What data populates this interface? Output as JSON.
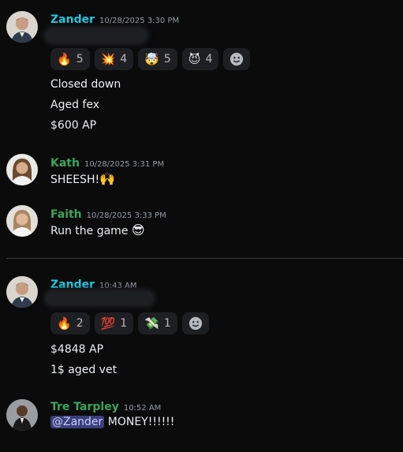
{
  "messages": [
    {
      "author": "Zander",
      "author_color": "#1ecbe1",
      "timestamp": "10/28/2025 3:30 PM",
      "reactions": [
        {
          "emoji": "🔥",
          "count": "5"
        },
        {
          "emoji": "💥",
          "count": "4"
        },
        {
          "emoji": "🤯",
          "count": "5"
        },
        {
          "emoji": "😈",
          "count": "4"
        }
      ],
      "lines": [
        "Closed down",
        "Aged fex",
        "$600 AP"
      ]
    },
    {
      "author": "Kath",
      "author_color": "#3ba55d",
      "timestamp": "10/28/2025 3:31 PM",
      "text": "SHEESH!",
      "emoji": "🙌"
    },
    {
      "author": "Faith",
      "author_color": "#3ba55d",
      "timestamp": "10/28/2025 3:33 PM",
      "text": "Run the game",
      "emoji": "😎"
    },
    {
      "author": "Zander",
      "author_color": "#1ecbe1",
      "timestamp": "10:43 AM",
      "reactions": [
        {
          "emoji": "🔥",
          "count": "2"
        },
        {
          "emoji": "💯",
          "count": "1"
        },
        {
          "emoji": "💸",
          "count": "1"
        }
      ],
      "lines": [
        "$4848 AP",
        "1$ aged vet"
      ]
    },
    {
      "author": "Tre Tarpley",
      "author_color": "#3ba55d",
      "timestamp": "10:52 AM",
      "mention": "@Zander",
      "text": "MONEY!!!!!!"
    }
  ],
  "icons": {
    "add_reaction": "add-reaction-smiley-icon"
  }
}
